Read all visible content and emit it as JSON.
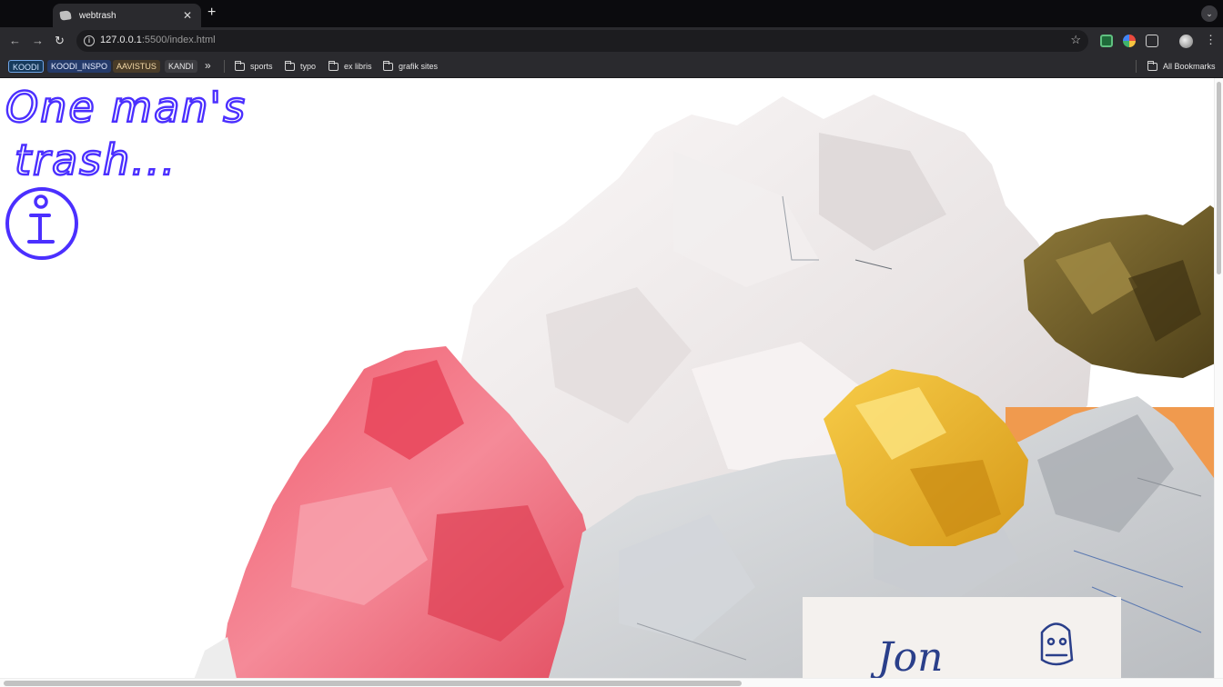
{
  "browser": {
    "tab": {
      "title": "webtrash"
    },
    "address": {
      "host": "127.0.0.1",
      "rest": ":5500/index.html"
    },
    "bookmarks": {
      "chips": [
        "KOODI",
        "KOODI_INSPO",
        "AAVISTUS",
        "KANDI"
      ],
      "folders": [
        "sports",
        "typo",
        "ex libris",
        "grafik sites"
      ],
      "all_label": "All Bookmarks"
    }
  },
  "page": {
    "heading_line1": "One man's",
    "heading_line2": "trash...",
    "accent_color": "#4b2fff",
    "note_text": "Jon"
  }
}
